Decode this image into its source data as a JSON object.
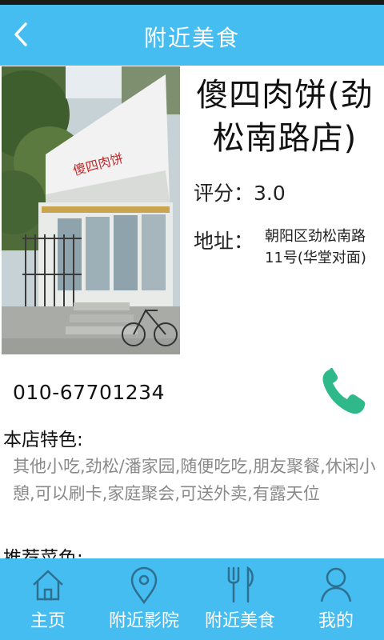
{
  "header": {
    "title": "附近美食",
    "back_icon": "chevron-left-icon"
  },
  "restaurant": {
    "name": "傻四肉饼(劲松南路店)",
    "rating_label": "评分：",
    "rating_value": "3.0",
    "address_label": "地址：",
    "address_value": "朝阳区劲松南路11号(华堂对面)",
    "phone": "010-67701234",
    "phone_icon": "phone-icon",
    "features_title": "本店特色:",
    "features_text": "其他小吃,劲松/潘家园,随便吃吃,朋友聚餐,休闲小憩,可以刷卡,家庭聚会,可送外卖,有露天位",
    "recommend_title": "推荐菜色:",
    "photo_sign": "傻四肉饼"
  },
  "bottom_nav": {
    "items": [
      {
        "label": "主页",
        "icon": "home-icon"
      },
      {
        "label": "附近影院",
        "icon": "location-pin-icon"
      },
      {
        "label": "附近美食",
        "icon": "fork-knife-icon"
      },
      {
        "label": "我的",
        "icon": "user-icon"
      }
    ]
  },
  "colors": {
    "accent": "#45bdf0",
    "phone_green": "#2fb98a",
    "nav_icon": "#2e6f8f"
  }
}
